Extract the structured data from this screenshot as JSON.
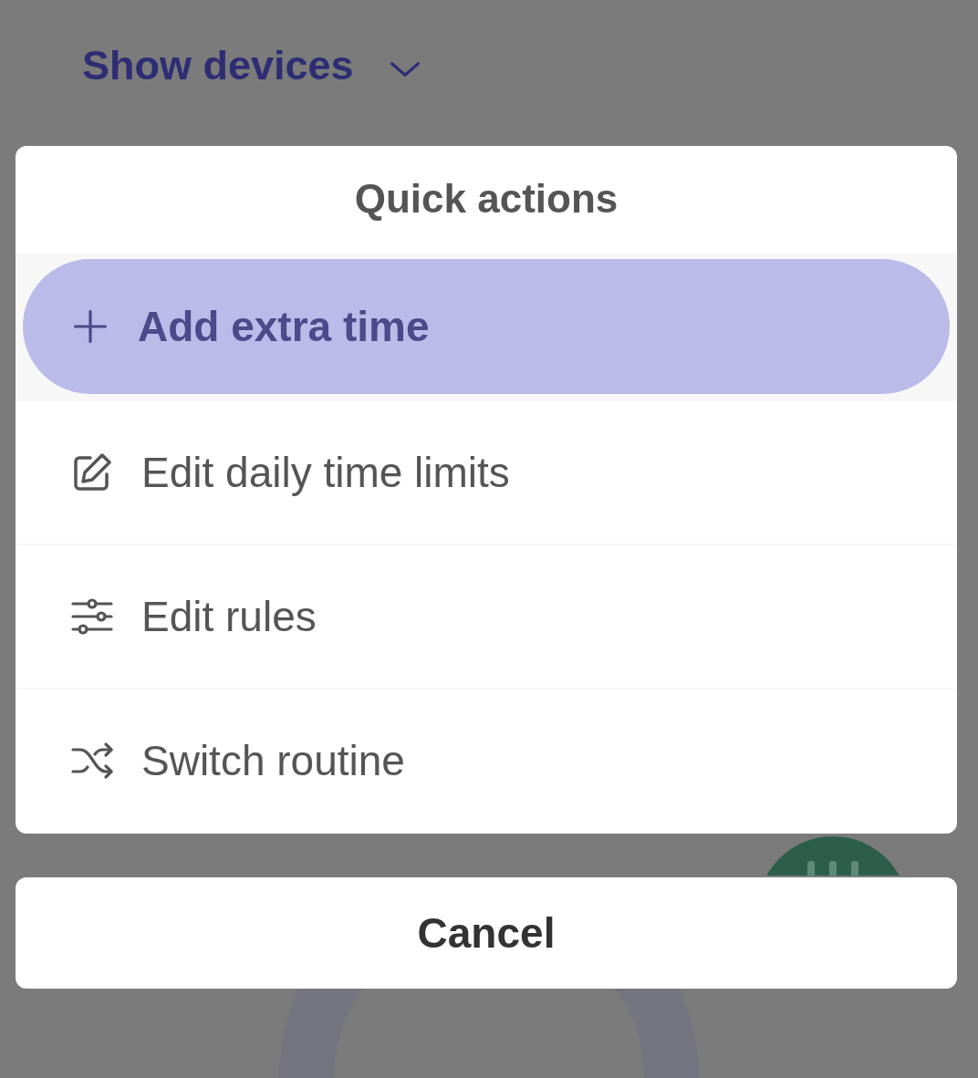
{
  "header": {
    "label": "Show devices"
  },
  "sheet": {
    "title": "Quick actions",
    "actions": [
      {
        "label": "Add extra time",
        "selected": true
      },
      {
        "label": "Edit daily time limits",
        "selected": false
      },
      {
        "label": "Edit rules",
        "selected": false
      },
      {
        "label": "Switch routine",
        "selected": false
      }
    ]
  },
  "cancel": {
    "label": "Cancel"
  }
}
